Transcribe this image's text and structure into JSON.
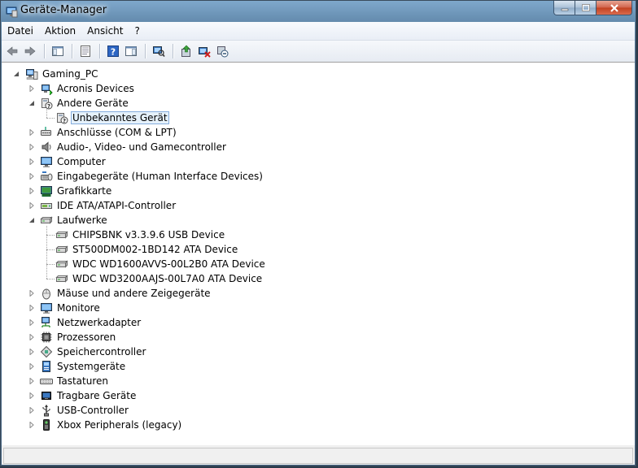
{
  "window": {
    "title": "Geräte-Manager"
  },
  "menu": [
    "Datei",
    "Aktion",
    "Ansicht",
    "?"
  ],
  "toolbar": [
    "back-icon",
    "forward-icon",
    "sep",
    "show-hide-console-tree-icon",
    "sep",
    "properties-icon",
    "sep",
    "help-icon",
    "action-pane-icon",
    "sep",
    "scan-hardware-icon",
    "sep",
    "update-driver-icon",
    "disable-device-icon",
    "uninstall-device-icon"
  ],
  "tree": {
    "root": {
      "label": "Gaming_PC",
      "icon": "computer-icon"
    },
    "items": [
      {
        "label": "Acronis Devices",
        "icon": "device-icon",
        "state": "collapsed"
      },
      {
        "label": "Andere Geräte",
        "icon": "unknown-device-icon",
        "state": "expanded",
        "children": [
          {
            "label": "Unbekanntes Gerät",
            "icon": "unknown-device-icon",
            "selected": true
          }
        ]
      },
      {
        "label": "Anschlüsse (COM & LPT)",
        "icon": "port-icon",
        "state": "collapsed"
      },
      {
        "label": "Audio-, Video- und Gamecontroller",
        "icon": "speaker-icon",
        "state": "collapsed"
      },
      {
        "label": "Computer",
        "icon": "monitor-icon",
        "state": "collapsed"
      },
      {
        "label": "Eingabegeräte (Human Interface Devices)",
        "icon": "hid-icon",
        "state": "collapsed"
      },
      {
        "label": "Grafikkarte",
        "icon": "display-adapter-icon",
        "state": "collapsed"
      },
      {
        "label": "IDE ATA/ATAPI-Controller",
        "icon": "ide-icon",
        "state": "collapsed"
      },
      {
        "label": "Laufwerke",
        "icon": "disk-icon",
        "state": "expanded",
        "children": [
          {
            "label": "CHIPSBNK v3.3.9.6 USB Device",
            "icon": "disk-icon"
          },
          {
            "label": "ST500DM002-1BD142 ATA Device",
            "icon": "disk-icon"
          },
          {
            "label": "WDC WD1600AVVS-00L2B0 ATA Device",
            "icon": "disk-icon"
          },
          {
            "label": "WDC WD3200AAJS-00L7A0 ATA Device",
            "icon": "disk-icon"
          }
        ]
      },
      {
        "label": "Mäuse und andere Zeigegeräte",
        "icon": "mouse-icon",
        "state": "collapsed"
      },
      {
        "label": "Monitore",
        "icon": "monitor-icon",
        "state": "collapsed"
      },
      {
        "label": "Netzwerkadapter",
        "icon": "network-icon",
        "state": "collapsed"
      },
      {
        "label": "Prozessoren",
        "icon": "cpu-icon",
        "state": "collapsed"
      },
      {
        "label": "Speichercontroller",
        "icon": "storage-controller-icon",
        "state": "collapsed"
      },
      {
        "label": "Systemgeräte",
        "icon": "system-device-icon",
        "state": "collapsed"
      },
      {
        "label": "Tastaturen",
        "icon": "keyboard-icon",
        "state": "collapsed"
      },
      {
        "label": "Tragbare Geräte",
        "icon": "portable-device-icon",
        "state": "collapsed"
      },
      {
        "label": "USB-Controller",
        "icon": "usb-icon",
        "state": "collapsed"
      },
      {
        "label": "Xbox Peripherals (legacy)",
        "icon": "xbox-icon",
        "state": "collapsed"
      }
    ]
  },
  "status": {
    "text": ""
  }
}
